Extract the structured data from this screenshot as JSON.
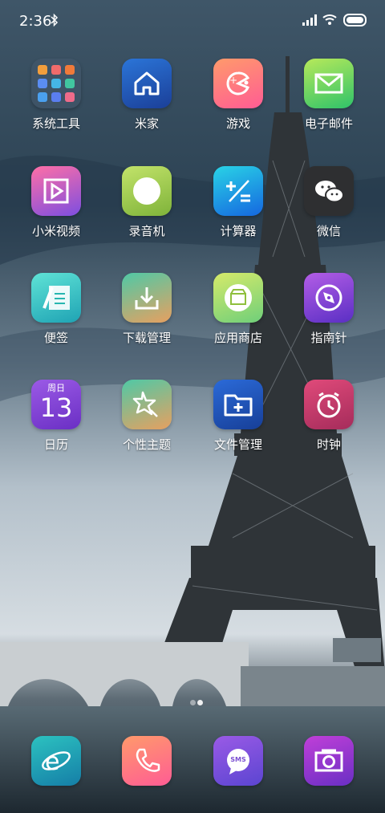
{
  "status_bar": {
    "time": "2:36"
  },
  "home": {
    "apps": [
      {
        "label": "系统工具",
        "icon": "folder-icon",
        "color": "#3a4a5a"
      },
      {
        "label": "米家",
        "icon": "home-icon",
        "color": "#1e5bb8"
      },
      {
        "label": "游戏",
        "icon": "gamepad-icon",
        "color": "#ff7a7f"
      },
      {
        "label": "电子邮件",
        "icon": "mail-icon",
        "color": "#39c94f"
      },
      {
        "label": "小米视频",
        "icon": "play-icon",
        "color": "#8b54d4"
      },
      {
        "label": "录音机",
        "icon": "record-icon",
        "color": "#8fbf3d"
      },
      {
        "label": "计算器",
        "icon": "calculator-icon",
        "color": "#1a7ee6"
      },
      {
        "label": "微信",
        "icon": "wechat-icon",
        "color": "#2b2b2b"
      },
      {
        "label": "便签",
        "icon": "notes-icon",
        "color": "#27b6b0"
      },
      {
        "label": "下载管理",
        "icon": "download-icon",
        "color": "#d8a564"
      },
      {
        "label": "应用商店",
        "icon": "store-icon",
        "color": "#9ad35e"
      },
      {
        "label": "指南针",
        "icon": "compass-icon",
        "color": "#7a3fd1"
      },
      {
        "label": "日历",
        "icon": "calendar-icon",
        "color": "#7a43d7",
        "header": "周日",
        "day": "13"
      },
      {
        "label": "个性主题",
        "icon": "theme-icon",
        "color": "#c89a5a"
      },
      {
        "label": "文件管理",
        "icon": "folder-add-icon",
        "color": "#1f4aa6"
      },
      {
        "label": "时钟",
        "icon": "clock-icon",
        "color": "#c43d71"
      }
    ],
    "page_indicator": {
      "pages": 2,
      "current": 2
    }
  },
  "dock": {
    "apps": [
      {
        "icon": "browser-icon",
        "color": "#1fa9b2"
      },
      {
        "icon": "phone-icon",
        "color": "#ff7c79"
      },
      {
        "icon": "sms-icon",
        "color": "#7b4fd2",
        "text": "SMS"
      },
      {
        "icon": "camera-icon",
        "color": "#8d3dc7"
      }
    ]
  }
}
